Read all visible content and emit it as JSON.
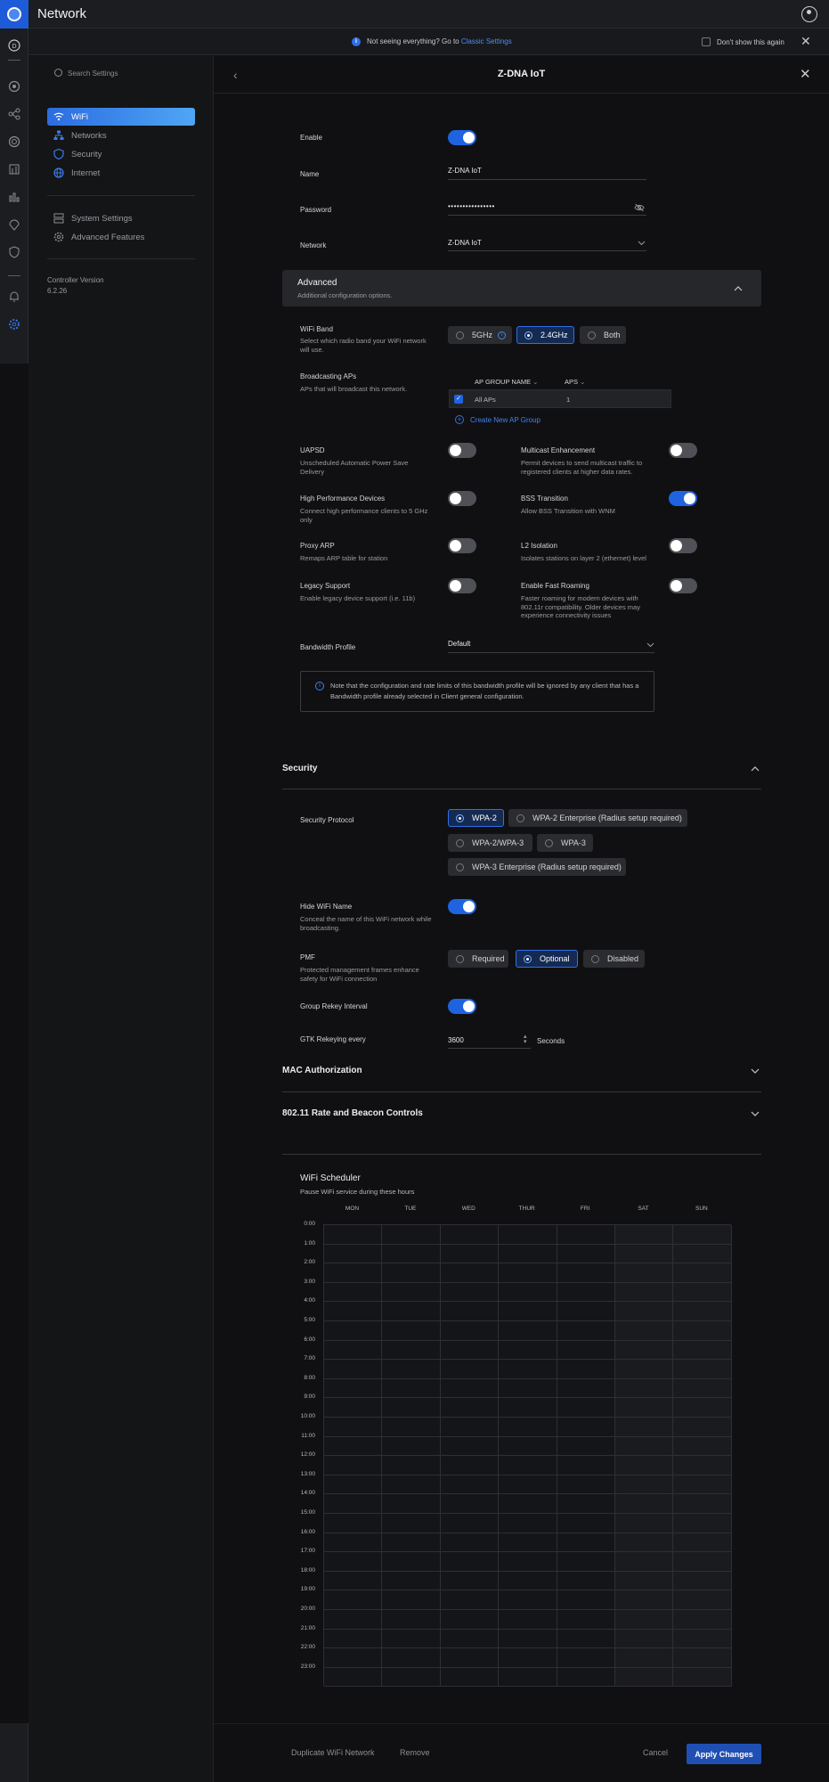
{
  "app": {
    "title": "Network"
  },
  "rail": {
    "items": [
      "dashboard-icon",
      "clients-icon",
      "topology-icon",
      "devices-icon",
      "statistics-icon",
      "insights-icon",
      "location-icon",
      "shield-icon",
      "alerts-icon",
      "settings-icon"
    ]
  },
  "notice": {
    "text": "Not seeing everything? Go to ",
    "link": "Classic Settings",
    "dont_show": "Don't show this again"
  },
  "sidebar": {
    "search_placeholder": "Search Settings",
    "items": [
      {
        "label": "WiFi",
        "icon": "wifi-icon",
        "active": true
      },
      {
        "label": "Networks",
        "icon": "networks-icon",
        "active": false
      },
      {
        "label": "Security",
        "icon": "shield-icon",
        "active": false
      },
      {
        "label": "Internet",
        "icon": "globe-icon",
        "active": false
      }
    ],
    "items2": [
      {
        "label": "System Settings",
        "icon": "server-icon"
      },
      {
        "label": "Advanced Features",
        "icon": "gear-icon"
      }
    ],
    "controller_label": "Controller Version",
    "controller_version": "6.2.26"
  },
  "header": {
    "title": "Z-DNA IoT"
  },
  "form": {
    "enable_label": "Enable",
    "enable": true,
    "name_label": "Name",
    "name_value": "Z-DNA IoT",
    "password_label": "Password",
    "password_value": "••••••••••••••••",
    "network_label": "Network",
    "network_value": "Z-DNA IoT"
  },
  "advanced": {
    "title": "Advanced",
    "subtitle": "Additional configuration options.",
    "wifi_band_label": "WiFi Band",
    "wifi_band_sub": "Select which radio band your WiFi network will use.",
    "wifi_band_options": [
      "5GHz",
      "2.4GHz",
      "Both"
    ],
    "wifi_band_selected": "2.4GHz",
    "broadcasting_label": "Broadcasting APs",
    "broadcasting_sub": "APs that will broadcast this network.",
    "ap_table": {
      "headers": [
        "AP GROUP NAME",
        "APS"
      ],
      "rows": [
        {
          "name": "All APs",
          "aps": "1",
          "checked": true
        }
      ]
    },
    "create_ap_group": "Create New AP Group",
    "toggles": [
      {
        "label": "UAPSD",
        "sub": "Unscheduled Automatic Power Save Delivery",
        "on": false
      },
      {
        "label": "Multicast Enhancement",
        "sub": "Permit devices to send multicast traffic to registered clients at higher data rates.",
        "on": false
      },
      {
        "label": "High Performance Devices",
        "sub": "Connect high performance clients to 5 GHz only",
        "on": false
      },
      {
        "label": "BSS Transition",
        "sub": "Allow BSS Transition with WNM",
        "on": true
      },
      {
        "label": "Proxy ARP",
        "sub": "Remaps ARP table for station",
        "on": false
      },
      {
        "label": "L2 Isolation",
        "sub": "Isolates stations on layer 2 (ethernet) level",
        "on": false
      },
      {
        "label": "Legacy Support",
        "sub": "Enable legacy device support (i.e. 11b)",
        "on": false
      },
      {
        "label": "Enable Fast Roaming",
        "sub": "Faster roaming for modern devices with 802.11r compatibility. Older devices may experience connectivity issues",
        "on": false
      }
    ],
    "bandwidth_label": "Bandwidth Profile",
    "bandwidth_value": "Default",
    "bandwidth_note": "Note that the configuration and rate limits of this bandwidth profile will be ignored by any client that has a Bandwidth profile already selected in Client general configuration."
  },
  "security": {
    "title": "Security",
    "protocol_label": "Security Protocol",
    "protocol_options": [
      "WPA-2",
      "WPA-2 Enterprise (Radius setup required)",
      "WPA-2/WPA-3",
      "WPA-3",
      "WPA-3 Enterprise (Radius setup required)"
    ],
    "protocol_selected": "WPA-2",
    "hide_label": "Hide WiFi Name",
    "hide_sub": "Conceal the name of this WiFi network while broadcasting.",
    "hide": true,
    "pmf_label": "PMF",
    "pmf_sub": "Protected management frames enhance safety for WiFi connection",
    "pmf_options": [
      "Required",
      "Optional",
      "Disabled"
    ],
    "pmf_selected": "Optional",
    "rekey_label": "Group Rekey Interval",
    "rekey": true,
    "gtk_label": "GTK Rekeying every",
    "gtk_value": "3600",
    "gtk_unit": "Seconds"
  },
  "sections": {
    "mac": "MAC Authorization",
    "rate": "802.11 Rate and Beacon Controls"
  },
  "scheduler": {
    "title": "WiFi Scheduler",
    "subtitle": "Pause WiFi service during these hours",
    "days": [
      "MON",
      "TUE",
      "WED",
      "THUR",
      "FRI",
      "SAT",
      "SUN"
    ],
    "hours": [
      "0:00",
      "1:00",
      "2:00",
      "3:00",
      "4:00",
      "5:00",
      "6:00",
      "7:00",
      "8:00",
      "9:00",
      "10:00",
      "11:00",
      "12:00",
      "13:00",
      "14:00",
      "15:00",
      "16:00",
      "17:00",
      "18:00",
      "19:00",
      "20:00",
      "21:00",
      "22:00",
      "23:00"
    ]
  },
  "footer": {
    "duplicate": "Duplicate WiFi Network",
    "remove": "Remove",
    "cancel": "Cancel",
    "apply": "Apply Changes"
  },
  "colors": {
    "accent": "#1f63e0",
    "background": "#101012",
    "panel": "#141517"
  }
}
